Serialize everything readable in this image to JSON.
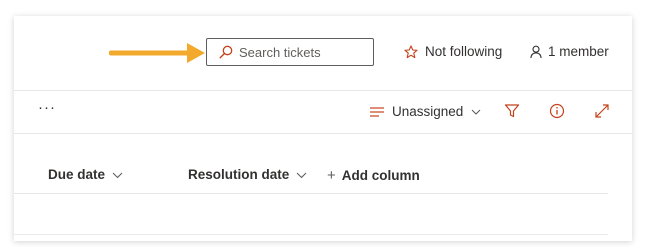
{
  "search": {
    "placeholder": "Search tickets"
  },
  "header": {
    "follow_label": "Not following",
    "members_label": "1 member"
  },
  "toolbar": {
    "more_label": "···",
    "group_by_label": "Unassigned"
  },
  "columns": [
    {
      "label": "Due date"
    },
    {
      "label": "Resolution date"
    },
    {
      "label": "Add column"
    }
  ],
  "colors": {
    "accent": "#c4421b",
    "arrow": "#f2a92c",
    "text": "#323130",
    "border": "#605e5c"
  },
  "icons": {
    "search": "search-icon",
    "follow": "star-icon",
    "members": "person-icon",
    "group_by": "lines-icon",
    "filter": "filter-icon",
    "info": "info-icon",
    "expand": "expand-icon"
  }
}
